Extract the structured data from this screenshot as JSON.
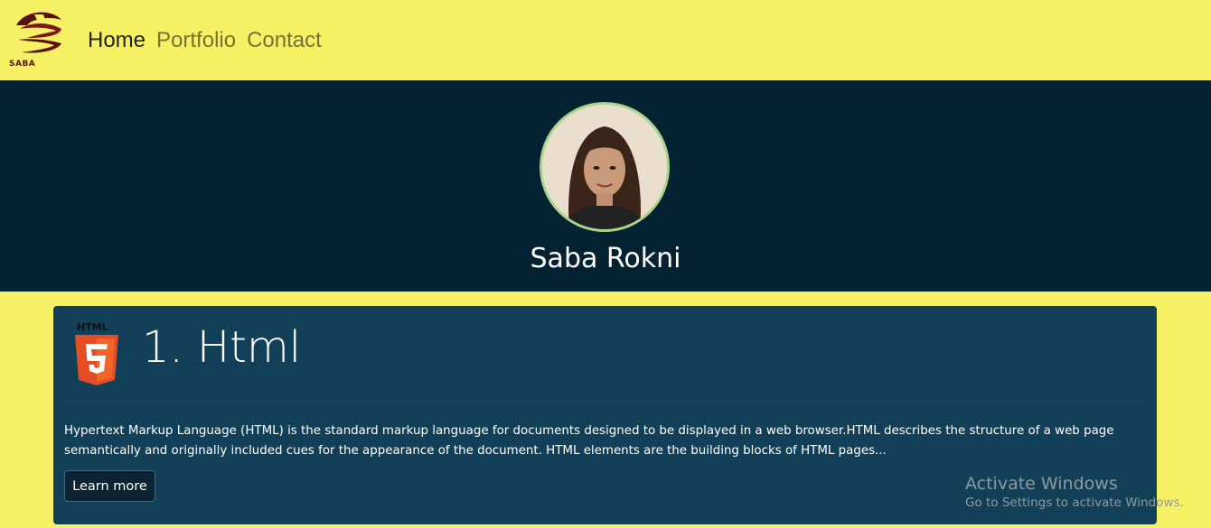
{
  "navbar": {
    "logo_text": "SABA",
    "links": [
      {
        "label": "Home",
        "active": true
      },
      {
        "label": "Portfolio",
        "active": false
      },
      {
        "label": "Contact",
        "active": false
      }
    ]
  },
  "hero": {
    "name": "Saba Rokni"
  },
  "card": {
    "icon": "html5-icon",
    "title": "1. Html",
    "description": "Hypertext Markup Language (HTML) is the standard markup language for documents designed to be displayed in a web browser.HTML describes the structure of a web page semantically and originally included cues for the appearance of the document. HTML elements are the building blocks of HTML pages...",
    "button_label": "Learn more"
  },
  "watermark": {
    "line1": "Activate Windows",
    "line2": "Go to Settings to activate Windows."
  },
  "colors": {
    "page_bg": "#f6f064",
    "hero_bg": "#042232",
    "card_bg": "#124058",
    "avatar_border": "#a7d48a",
    "logo_color": "#5a1010"
  }
}
